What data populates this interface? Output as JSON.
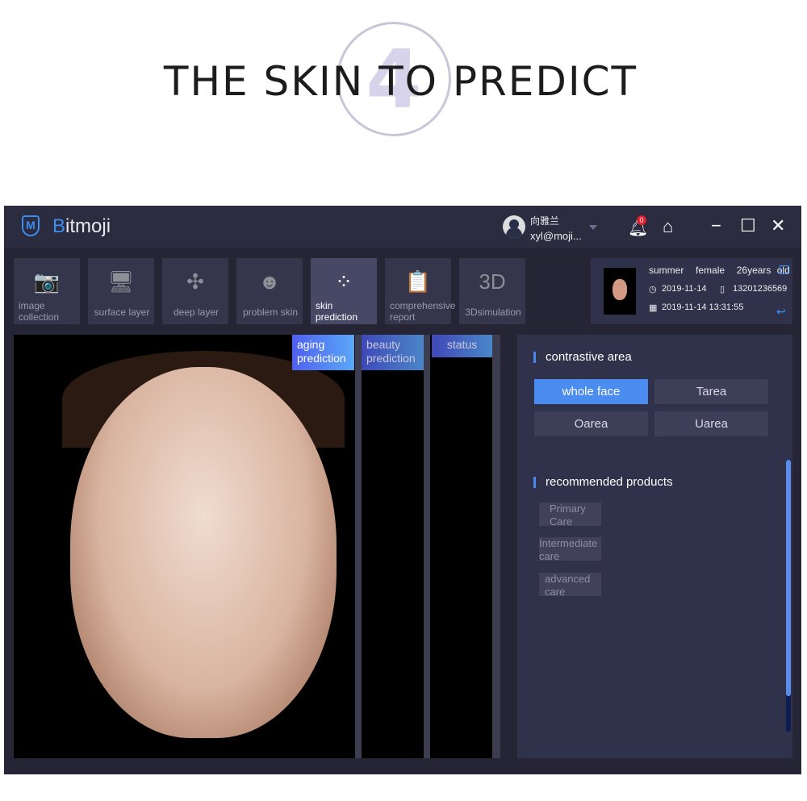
{
  "hero": {
    "title": "THE SKIN TO PREDICT",
    "step": "4"
  },
  "app": {
    "name_first": "B",
    "name_rest": "itmoji"
  },
  "user": {
    "name": "向雅兰",
    "email": "xyl@moji...",
    "notifications": "0"
  },
  "window_controls": {
    "minimize": "−",
    "maximize": "☐",
    "close": "✕"
  },
  "tabs": [
    {
      "label": "image collection",
      "icon": "camera-icon",
      "glyph": "📷"
    },
    {
      "label": "surface layer",
      "icon": "monitor-icon",
      "glyph": "🖥"
    },
    {
      "label": "deep layer",
      "icon": "molecule-icon",
      "glyph": "✣"
    },
    {
      "label": "problem skin",
      "icon": "mask-icon",
      "glyph": "☻"
    },
    {
      "label": "skin prediction",
      "icon": "bubbles-icon",
      "glyph": "⁘"
    },
    {
      "label": "comprehensive report",
      "icon": "clipboard-chart-icon",
      "glyph": "📋"
    },
    {
      "label": "3Dsimulation",
      "icon": "3d-icon",
      "glyph": "3D"
    }
  ],
  "active_tab": "skin prediction",
  "client": {
    "name": "summer",
    "gender": "female",
    "age": "26years old",
    "date": "2019-11-14",
    "phone": "13201236569",
    "datetime": "2019-11-14 13:31:55"
  },
  "prediction_tabs": [
    "aging prediction",
    "beauty prediction",
    "status"
  ],
  "contrastive": {
    "title": "contrastive area",
    "options": [
      "whole face",
      "Tarea",
      "Oarea",
      "Uarea"
    ],
    "selected": "whole face"
  },
  "recommended": {
    "title": "recommended products",
    "items": [
      "Primary Care",
      "Intermediate care",
      "advanced care"
    ]
  },
  "colors": {
    "accent": "#4a8cf0",
    "bg": "#252536",
    "panel": "#30314a"
  }
}
